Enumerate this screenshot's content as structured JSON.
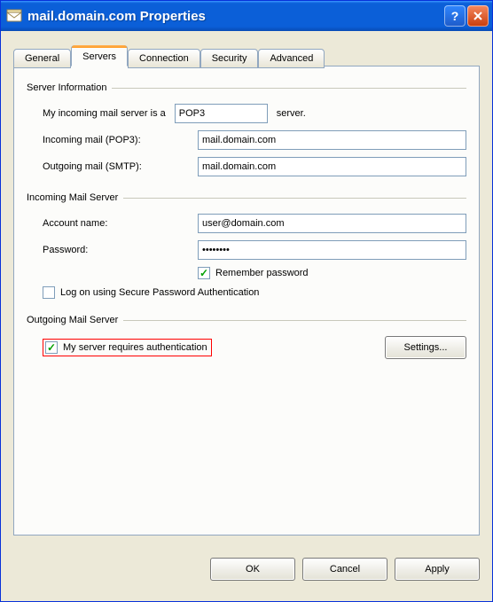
{
  "window": {
    "title": "mail.domain.com Properties"
  },
  "tabs": {
    "general": "General",
    "servers": "Servers",
    "connection": "Connection",
    "security": "Security",
    "advanced": "Advanced"
  },
  "server_info": {
    "group_title": "Server Information",
    "type_prefix": "My incoming mail server is a",
    "type_value": "POP3",
    "type_suffix": "server.",
    "incoming_label": "Incoming mail (POP3):",
    "incoming_value": "mail.domain.com",
    "outgoing_label": "Outgoing mail (SMTP):",
    "outgoing_value": "mail.domain.com"
  },
  "incoming_server": {
    "group_title": "Incoming Mail Server",
    "account_label": "Account name:",
    "account_value": "user@domain.com",
    "password_label": "Password:",
    "password_value": "••••••••",
    "remember_label": "Remember password",
    "spa_label": "Log on using Secure Password Authentication"
  },
  "outgoing_server": {
    "group_title": "Outgoing Mail Server",
    "auth_label": "My server requires authentication",
    "settings_button": "Settings..."
  },
  "buttons": {
    "ok": "OK",
    "cancel": "Cancel",
    "apply": "Apply"
  }
}
